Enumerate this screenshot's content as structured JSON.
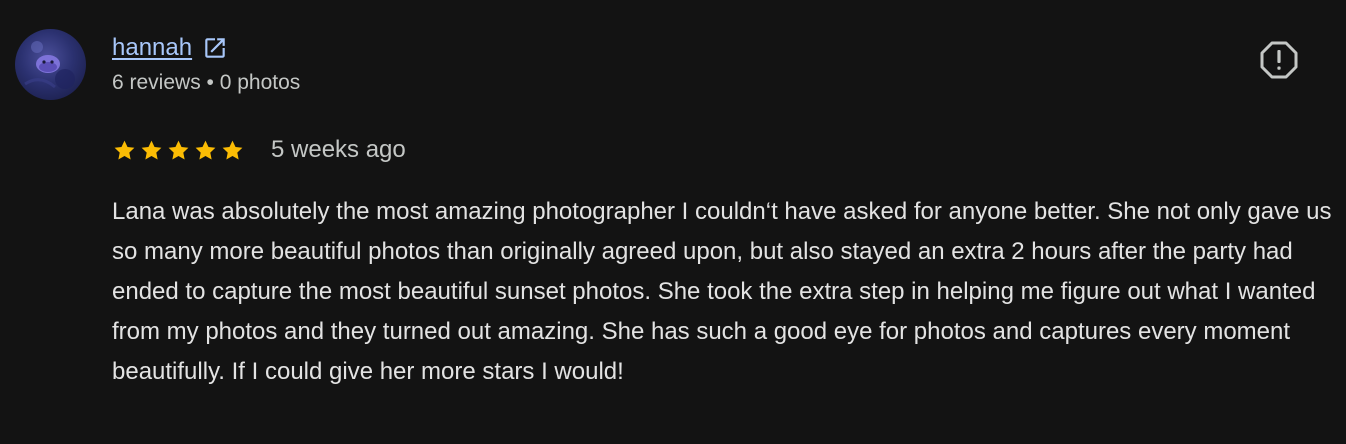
{
  "reviewer": {
    "name": "hannah",
    "meta": "6 reviews • 0 photos",
    "avatar_icon": "profile-avatar"
  },
  "review": {
    "rating": 5,
    "max_rating": 5,
    "time": "5 weeks ago",
    "text": "Lana was absolutely the most amazing photographer I couldn‘t have asked for anyone better. She not only gave us so many more beautiful photos than originally agreed upon, but also stayed an extra 2 hours after the party had ended to capture the most beautiful sunset photos. She took the extra step in helping me figure out what I wanted from my photos and they turned out amazing. She has such a good eye for photos and captures every moment beautifully. If I could give her more stars I would!"
  },
  "icons": {
    "external": "external-link-icon",
    "report": "report-icon",
    "star": "star-icon"
  },
  "colors": {
    "background": "#131313",
    "link": "#a8c7fa",
    "star": "#fbbc04",
    "text": "#e3e3e3",
    "muted": "#c4c7c5"
  }
}
